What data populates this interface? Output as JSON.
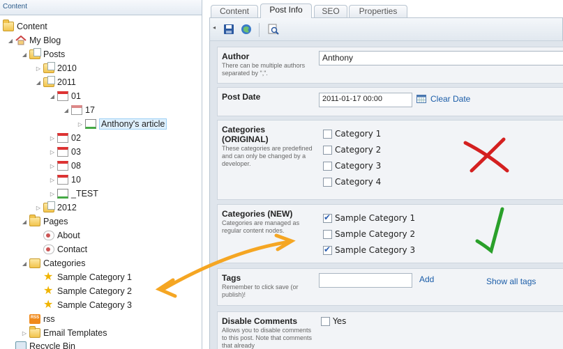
{
  "tree": {
    "header": "Content",
    "nodes": [
      {
        "label": "Content"
      },
      {
        "label": "My Blog"
      },
      {
        "label": "Posts"
      },
      {
        "label": "2010"
      },
      {
        "label": "2011"
      },
      {
        "label": "01"
      },
      {
        "label": "17"
      },
      {
        "label": "Anthony's article"
      },
      {
        "label": "02"
      },
      {
        "label": "03"
      },
      {
        "label": "08"
      },
      {
        "label": "10"
      },
      {
        "label": "_TEST"
      },
      {
        "label": "2012"
      },
      {
        "label": "Pages"
      },
      {
        "label": "About"
      },
      {
        "label": "Contact"
      },
      {
        "label": "Categories"
      },
      {
        "label": "Sample Category 1"
      },
      {
        "label": "Sample Category 2"
      },
      {
        "label": "Sample Category 3"
      },
      {
        "label": "rss"
      },
      {
        "label": "Email Templates"
      },
      {
        "label": "Recycle Bin"
      }
    ]
  },
  "tabs": [
    "Content",
    "Post Info",
    "SEO",
    "Properties"
  ],
  "active_tab": "Post Info",
  "form": {
    "author": {
      "label": "Author",
      "desc": "There can be multiple authors separated by \",\".",
      "value": "Anthony"
    },
    "post_date": {
      "label": "Post Date",
      "value": "2011-01-17 00:00",
      "clear": "Clear Date"
    },
    "cat_original": {
      "label": "Categories (ORIGINAL)",
      "desc": "These categories are predefined and can only be changed by a developer.",
      "options": [
        {
          "label": "Category 1",
          "checked": false
        },
        {
          "label": "Category 2",
          "checked": false
        },
        {
          "label": "Category 3",
          "checked": false
        },
        {
          "label": "Category 4",
          "checked": false
        }
      ]
    },
    "cat_new": {
      "label": "Categories (NEW)",
      "desc": "Categories are managed as regular content nodes.",
      "options": [
        {
          "label": "Sample Category 1",
          "checked": true
        },
        {
          "label": "Sample Category 2",
          "checked": false
        },
        {
          "label": "Sample Category 3",
          "checked": true
        }
      ]
    },
    "tags": {
      "label": "Tags",
      "desc": "Remember to click save (or publish)!",
      "value": "",
      "add": "Add",
      "show_all": "Show all tags"
    },
    "disable_comments": {
      "label": "Disable Comments",
      "desc": "Allows you to disable comments to this post. Note that comments that already",
      "option": "Yes",
      "checked": false
    }
  },
  "annotation_colors": {
    "cross": "#d42020",
    "check": "#2aa02a",
    "arrow": "#f5a623"
  }
}
